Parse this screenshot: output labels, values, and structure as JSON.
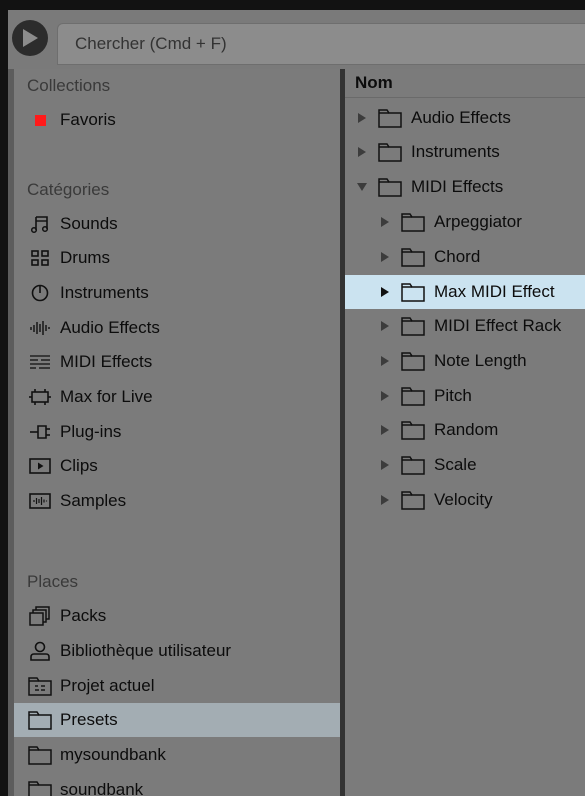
{
  "search": {
    "placeholder": "Chercher (Cmd + F)"
  },
  "sidebar": {
    "collections_header": "Collections",
    "collections": [
      {
        "label": "Favoris",
        "icon": "red-square-icon",
        "color": "#ff1a1a"
      }
    ],
    "categories_header": "Catégories",
    "categories": [
      {
        "label": "Sounds",
        "icon": "sounds-icon"
      },
      {
        "label": "Drums",
        "icon": "drums-icon"
      },
      {
        "label": "Instruments",
        "icon": "instruments-icon"
      },
      {
        "label": "Audio Effects",
        "icon": "audio-effects-icon"
      },
      {
        "label": "MIDI Effects",
        "icon": "midi-effects-icon"
      },
      {
        "label": "Max for Live",
        "icon": "max-for-live-icon"
      },
      {
        "label": "Plug-ins",
        "icon": "plug-ins-icon"
      },
      {
        "label": "Clips",
        "icon": "clips-icon"
      },
      {
        "label": "Samples",
        "icon": "samples-icon"
      }
    ],
    "places_header": "Places",
    "places": [
      {
        "label": "Packs",
        "icon": "packs-icon"
      },
      {
        "label": "Bibliothèque utilisateur",
        "icon": "user-library-icon"
      },
      {
        "label": "Projet actuel",
        "icon": "current-project-icon"
      },
      {
        "label": "Presets",
        "icon": "folder-icon",
        "selected": true
      },
      {
        "label": "mysoundbank",
        "icon": "folder-icon"
      },
      {
        "label": "soundbank",
        "icon": "folder-icon"
      }
    ]
  },
  "browser": {
    "column_header": "Nom",
    "items": [
      {
        "label": "Audio Effects",
        "expanded": false
      },
      {
        "label": "Instruments",
        "expanded": false
      },
      {
        "label": "MIDI Effects",
        "expanded": true
      },
      {
        "label": "Arpeggiator",
        "expanded": false
      },
      {
        "label": "Chord",
        "expanded": false
      },
      {
        "label": "Max MIDI Effect",
        "expanded": false,
        "selected": true
      },
      {
        "label": "MIDI Effect Rack",
        "expanded": false
      },
      {
        "label": "Note Length",
        "expanded": false
      },
      {
        "label": "Pitch",
        "expanded": false
      },
      {
        "label": "Random",
        "expanded": false
      },
      {
        "label": "Scale",
        "expanded": false
      },
      {
        "label": "Velocity",
        "expanded": false
      }
    ]
  },
  "colors": {
    "selection_left": "#a3adb3",
    "selection_right": "#cbe3f0",
    "favorite": "#ff1a1a"
  }
}
